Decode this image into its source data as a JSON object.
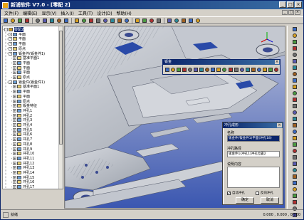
{
  "window": {
    "title": "新浦软件 V7.0 - [零配 2]",
    "controls": [
      "_",
      "□",
      "×"
    ]
  },
  "menubar": {
    "items": [
      "文件(F)",
      "编辑(E)",
      "显示(V)",
      "插入(I)",
      "工具(T)",
      "设计(D)",
      "帮助(H)"
    ],
    "mdi_controls": [
      "_",
      "□",
      "×"
    ]
  },
  "toolbar": {
    "icons": [
      "new-icon",
      "open-icon",
      "save-icon",
      "print-icon",
      "cut-icon",
      "copy-icon",
      "paste-icon",
      "undo-icon",
      "redo-icon",
      "select-icon",
      "delete-icon",
      "move-icon",
      "rotate-icon",
      "pan-icon",
      "zoom-icon",
      "zoom-window-icon",
      "zoom-fit-icon",
      "view-front-icon",
      "view-top-icon",
      "view-side-icon",
      "view-iso-icon",
      "shade-icon",
      "wireframe-icon",
      "hidden-line-icon",
      "measure-icon",
      "help-icon"
    ]
  },
  "tree": {
    "items": [
      {
        "label": "零配2",
        "level": 0,
        "selected": true
      },
      {
        "label": "平面",
        "level": 1
      },
      {
        "label": "平面",
        "level": 1
      },
      {
        "label": "平面",
        "level": 1
      },
      {
        "label": "原点",
        "level": 1
      },
      {
        "label": "钣金件(钣金件1)",
        "level": 1
      },
      {
        "label": "基准平面1",
        "level": 2
      },
      {
        "label": "平面",
        "level": 2
      },
      {
        "label": "平面",
        "level": 2
      },
      {
        "label": "平面",
        "level": 2
      },
      {
        "label": "原点",
        "level": 2
      },
      {
        "label": "钣金件(钣金件1)",
        "level": 1
      },
      {
        "label": "基准平面1",
        "level": 2
      },
      {
        "label": "平面",
        "level": 2
      },
      {
        "label": "平面",
        "level": 2
      },
      {
        "label": "原点",
        "level": 2
      },
      {
        "label": "钣金特征",
        "level": 2
      },
      {
        "label": "冲孔1",
        "level": 2
      },
      {
        "label": "冲孔2",
        "level": 2
      },
      {
        "label": "冲孔3",
        "level": 2
      },
      {
        "label": "冲孔4",
        "level": 2
      },
      {
        "label": "冲孔5",
        "level": 2
      },
      {
        "label": "冲孔6",
        "level": 2
      },
      {
        "label": "冲孔7",
        "level": 2
      },
      {
        "label": "冲孔8",
        "level": 2
      },
      {
        "label": "冲孔9",
        "level": 2
      },
      {
        "label": "冲孔10",
        "level": 2
      },
      {
        "label": "冲孔11",
        "level": 2
      },
      {
        "label": "冲孔12",
        "level": 2
      },
      {
        "label": "冲孔13",
        "level": 2
      },
      {
        "label": "冲孔14",
        "level": 2
      },
      {
        "label": "冲孔15",
        "level": 2
      },
      {
        "label": "冲孔16",
        "level": 2
      },
      {
        "label": "冲孔17",
        "level": 2
      }
    ]
  },
  "float_toolbar": {
    "title": "钣金",
    "icons": [
      "plate-icon",
      "bend-icon",
      "flange-icon",
      "hem-icon",
      "jog-icon",
      "punch-icon",
      "notch-icon",
      "relief-icon",
      "unfold-icon",
      "fold-icon",
      "corner-icon",
      "rib-icon",
      "louver-icon",
      "emboss-icon",
      "lance-icon",
      "stamp-icon",
      "cut-icon",
      "seam-icon",
      "tab-icon",
      "flatten-icon"
    ]
  },
  "dialog": {
    "title": "冲孔成形",
    "name_label": "名称",
    "name_value": "钣金件(钣金件1)平面(冲孔18)",
    "path_label": "冲孔路径",
    "path_value": "钣金件1(冲孔1)冲孔位置2",
    "desc_label": "说明内容",
    "check_auto_label": "自动冲孔",
    "check_auto_checked": true,
    "check_reverse_label": "反向冲孔",
    "check_reverse_checked": false,
    "ok_label": "确定",
    "cancel_label": "取消"
  },
  "right_toolbar": {
    "icons": [
      "arrow-icon",
      "line-icon",
      "arc-icon",
      "circle-icon",
      "rect-icon",
      "polygon-icon",
      "spline-icon",
      "offset-icon",
      "trim-icon",
      "extend-icon",
      "fillet-icon",
      "chamfer-icon",
      "mirror-icon",
      "pattern-icon",
      "dimension-icon",
      "constraint-icon",
      "text-icon",
      "hatch-icon",
      "layer-icon",
      "color-icon",
      "snap-icon",
      "grid-icon",
      "ortho-icon",
      "measure-icon",
      "section-icon",
      "render-icon",
      "light-icon",
      "camera-icon",
      "export-icon",
      "import-icon"
    ]
  },
  "statusbar": {
    "text": "就绪",
    "coords": "0.000 , 0.000 , 0.000"
  },
  "colors": {
    "title_bar": "#0a246a",
    "chrome": "#d4d0c8",
    "model_metal": "#b0b4bc",
    "viewport_bg": "#5470b8"
  }
}
